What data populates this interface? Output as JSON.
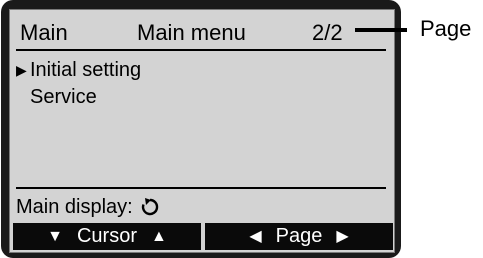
{
  "header": {
    "left": "Main",
    "title": "Main menu",
    "page_indicator": "2/2"
  },
  "menu": {
    "items": [
      {
        "label": "Initial setting",
        "selected": true
      },
      {
        "label": "Service",
        "selected": false
      }
    ],
    "cursor_glyph": "▶"
  },
  "footer": {
    "main_display_label": "Main display:",
    "return_icon": "return-icon"
  },
  "softkeys": [
    {
      "left_glyph": "▼",
      "label": "Cursor",
      "right_glyph": "▲"
    },
    {
      "left_glyph": "◀",
      "label": "Page",
      "right_glyph": "▶"
    }
  ],
  "callout": {
    "label": "Page"
  },
  "colors": {
    "screen_bg": "#d3d3d3",
    "frame": "#1a1a1a",
    "softkey_bg": "#0a0a0a",
    "text": "#000000"
  }
}
